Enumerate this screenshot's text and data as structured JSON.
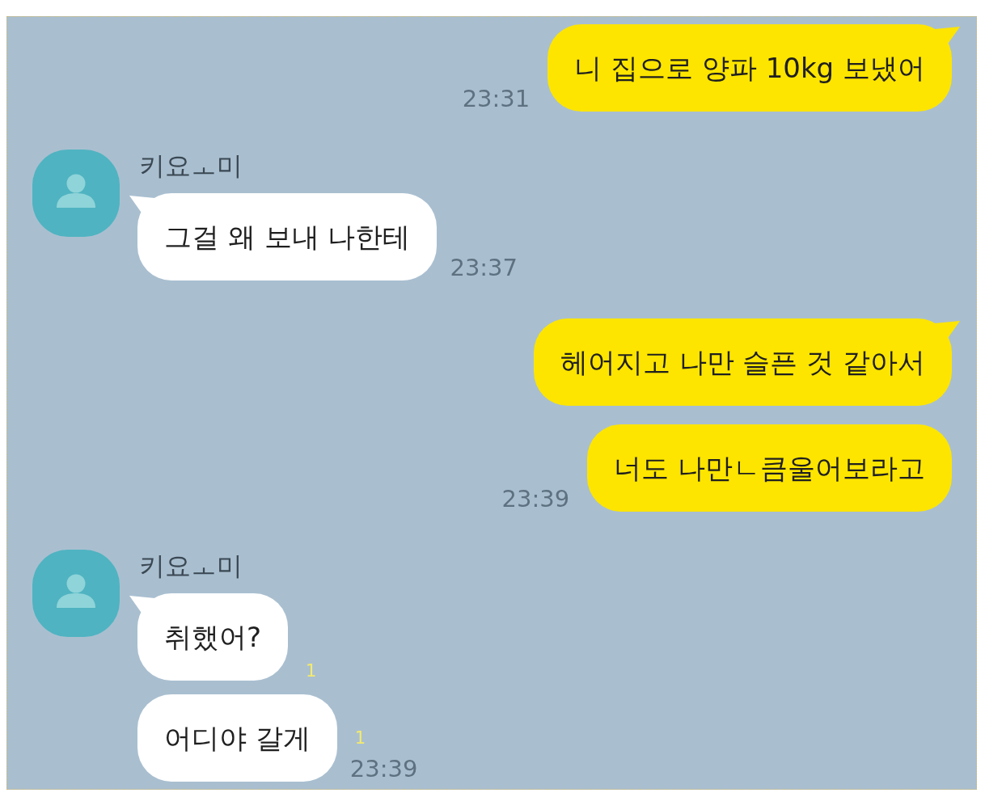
{
  "chat": {
    "groups": [
      {
        "kind": "sent",
        "bubbles": [
          {
            "text": "니 집으로 양파 10kg 보냈어",
            "time": "23:31"
          }
        ]
      },
      {
        "kind": "received",
        "sender": "키요ㅗ미",
        "bubbles": [
          {
            "text": "그걸 왜 보내 나한테",
            "time": "23:37"
          }
        ]
      },
      {
        "kind": "sent",
        "bubbles": [
          {
            "text": "헤어지고 나만 슬픈 것 같아서"
          },
          {
            "text": "너도 나만ㄴ큼울어보라고",
            "time": "23:39"
          }
        ]
      },
      {
        "kind": "received",
        "sender": "키요ㅗ미",
        "bubbles": [
          {
            "text": "취했어?",
            "unread": "1"
          },
          {
            "text": "어디야 갈게",
            "unread": "1",
            "time": "23:39"
          }
        ]
      }
    ]
  }
}
